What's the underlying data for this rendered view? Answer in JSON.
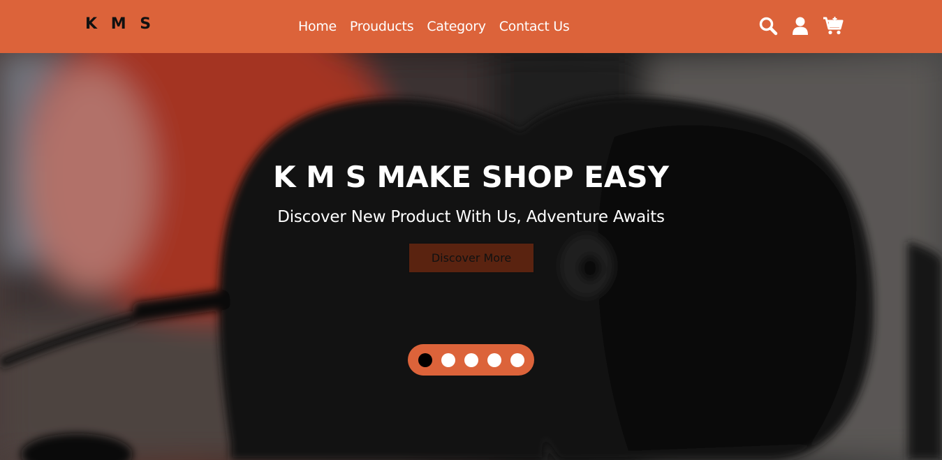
{
  "header": {
    "logo": "K M S",
    "nav": [
      "Home",
      "Prouducts",
      "Category",
      "Contact Us"
    ],
    "icons": [
      "search-icon",
      "user-icon",
      "cart-icon"
    ]
  },
  "hero": {
    "title": "K M S MAKE SHOP EASY",
    "subtitle": "Discover New Product With Us, Adventure Awaits",
    "button_label": "Discover More",
    "slides_total": 5,
    "active_slide": 1
  },
  "colors": {
    "accent": "#dc633a",
    "button_bg": "#5a2310",
    "text_light": "#ffffff",
    "text_dark": "#111111"
  }
}
